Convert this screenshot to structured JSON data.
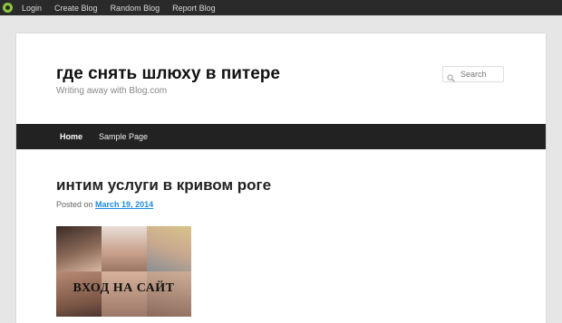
{
  "topbar": {
    "links": [
      "Login",
      "Create Blog",
      "Random Blog",
      "Report Blog"
    ]
  },
  "header": {
    "title": "где снять шлюху в питере",
    "description": "Writing away with Blog.com"
  },
  "search": {
    "placeholder": "Search"
  },
  "nav": {
    "items": [
      "Home",
      "Sample Page"
    ]
  },
  "post": {
    "title": "интим услуги в кривом роге",
    "posted_label": "Posted on",
    "date": "March 19, 2014",
    "image_text": "ВХОД НА САЙТ"
  },
  "colors": {
    "topbar_bg": "#2a2a2a",
    "nav_bg": "#222222",
    "link_accent": "#1b8be0",
    "logo_green": "#8ec63f"
  }
}
